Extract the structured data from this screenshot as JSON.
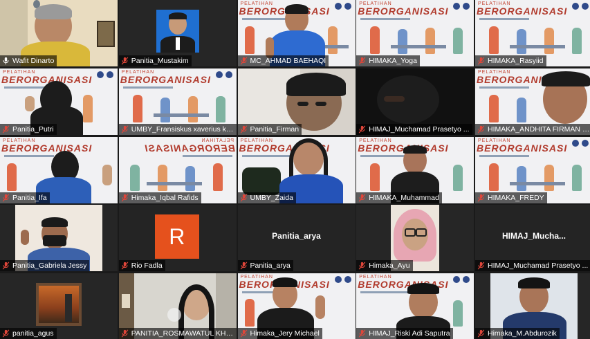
{
  "slide": {
    "title_small": "PELATIHAN",
    "title_large": "BERORGANISASI"
  },
  "participants": [
    {
      "name": "Wafit Dinarto",
      "mic": "on"
    },
    {
      "name": "Panitia_Mustakim",
      "mic": "muted"
    },
    {
      "name": "MC_AHMAD BAEHAQI",
      "mic": "muted"
    },
    {
      "name": "HIMAKA_Yoga",
      "mic": "muted"
    },
    {
      "name": "HIMAKA_Rasyiid",
      "mic": "muted"
    },
    {
      "name": "Panitia_Putri",
      "mic": "muted"
    },
    {
      "name": "UMBY_Fransiskus xaverius kati...",
      "mic": "muted"
    },
    {
      "name": "Panitia_Firman",
      "mic": "muted"
    },
    {
      "name": "HIMAJ_Muchamad Prasetyo ...",
      "mic": "muted"
    },
    {
      "name": "HIMAKA_ANDHITA FIRMAN S...",
      "mic": "muted"
    },
    {
      "name": "Panitia_Ifa",
      "mic": "muted"
    },
    {
      "name": "Himaka_Iqbal Rafids",
      "mic": "muted"
    },
    {
      "name": "UMBY_Zaida",
      "mic": "muted"
    },
    {
      "name": "HIMAKA_Muhammad",
      "mic": "muted"
    },
    {
      "name": "HIMAKA_FREDY",
      "mic": "muted"
    },
    {
      "name": "Panitia_Gabriela Jessy",
      "mic": "muted"
    },
    {
      "name": "Rio Fadla",
      "mic": "muted",
      "avatar_letter": "R"
    },
    {
      "name": "Panitia_arya",
      "mic": "muted",
      "display_name": "Panitia_arya"
    },
    {
      "name": "Himaka_Ayu",
      "mic": "muted"
    },
    {
      "name": "HIMAJ_Muchamad Prasetyo ...",
      "mic": "muted",
      "display_name": "HIMAJ_Mucha..."
    },
    {
      "name": "panitia_agus",
      "mic": "muted"
    },
    {
      "name": "PANITIA_ROSMAWATUL KHOTI...",
      "mic": "muted"
    },
    {
      "name": "Himaka_Jery Michael",
      "mic": "muted"
    },
    {
      "name": "HIMAJ_Riski Adi Saputra",
      "mic": "muted"
    },
    {
      "name": "Himaka_M.Abdurozik",
      "mic": "muted"
    }
  ],
  "colors": {
    "active_speaker": "#b7e24f",
    "muted_mic": "#e0463a",
    "avatar_bg": "#e5511d"
  }
}
